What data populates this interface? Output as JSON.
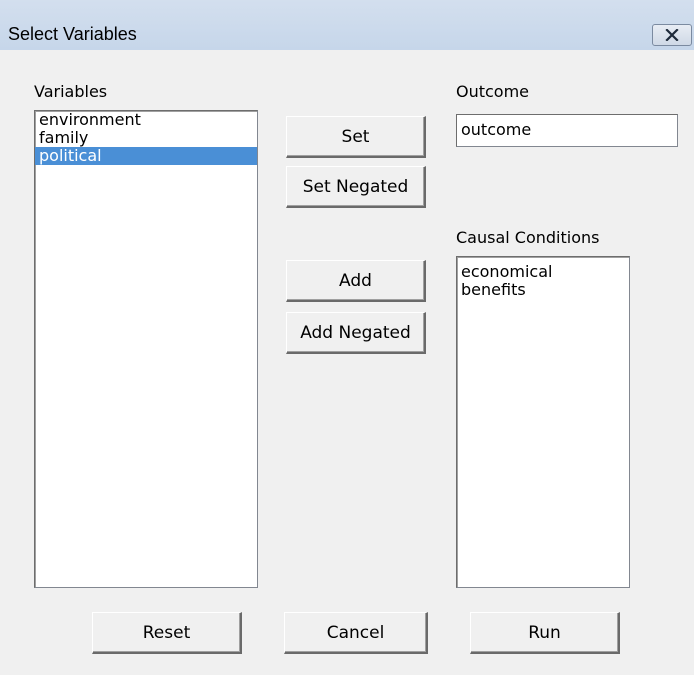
{
  "window": {
    "title": "Select Variables"
  },
  "variables": {
    "label": "Variables",
    "items": [
      "environment",
      "family",
      "political"
    ],
    "selected": "political"
  },
  "outcome": {
    "label": "Outcome",
    "value": "outcome"
  },
  "causal_conditions": {
    "label": "Causal Conditions",
    "items": [
      "economical",
      "benefits"
    ]
  },
  "buttons": {
    "set": "Set",
    "set_negated": "Set Negated",
    "add": "Add",
    "add_negated": "Add Negated",
    "reset": "Reset",
    "cancel": "Cancel",
    "run": "Run"
  },
  "icons": {
    "close": "close-icon"
  }
}
